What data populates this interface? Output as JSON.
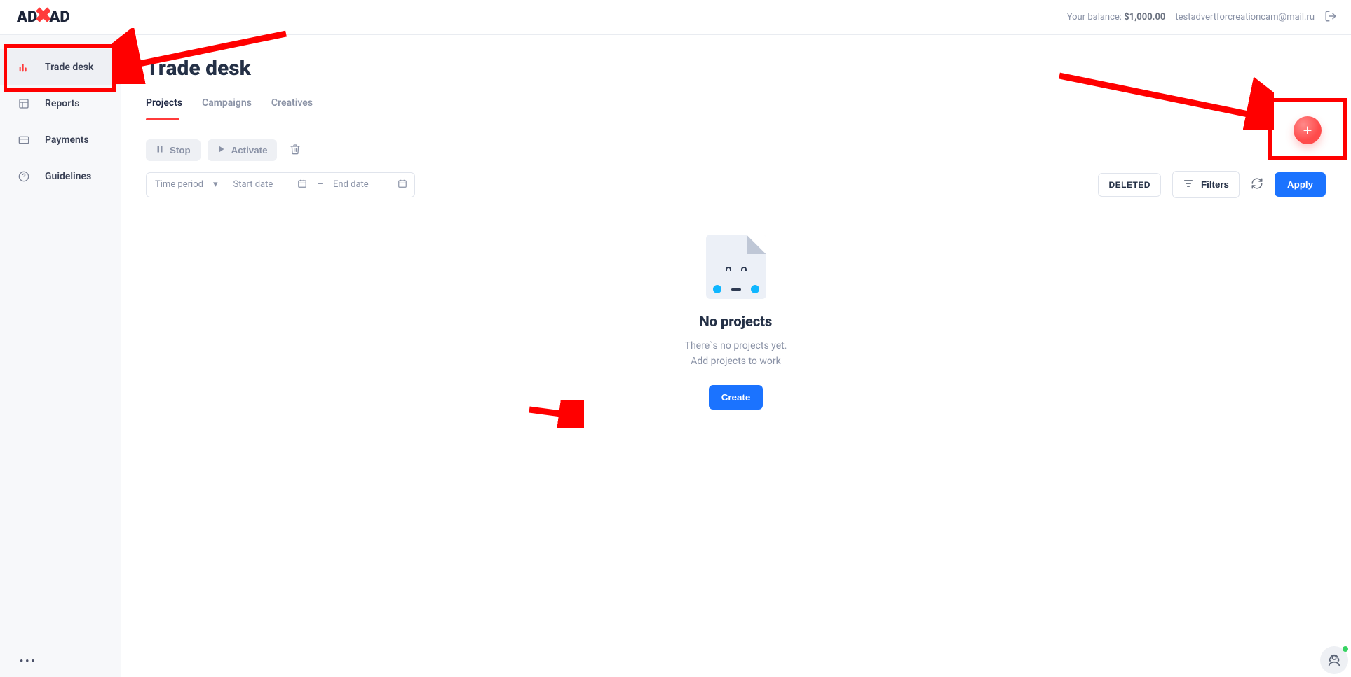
{
  "logo": {
    "a": "AD",
    "b": "AD"
  },
  "header": {
    "balance_label": "Your balance: ",
    "balance_value": "$1,000.00",
    "user_email": "testadvertforcreationcam@mail.ru"
  },
  "sidebar": {
    "items": [
      {
        "label": "Trade desk",
        "active": true
      },
      {
        "label": "Reports",
        "active": false
      },
      {
        "label": "Payments",
        "active": false
      },
      {
        "label": "Guidelines",
        "active": false
      }
    ]
  },
  "page": {
    "title": "Trade desk",
    "tabs": [
      {
        "label": "Projects",
        "active": true
      },
      {
        "label": "Campaigns",
        "active": false
      },
      {
        "label": "Creatives",
        "active": false
      }
    ]
  },
  "actions": {
    "stop": "Stop",
    "activate": "Activate"
  },
  "filters": {
    "period_label": "Time period",
    "start_placeholder": "Start date",
    "end_placeholder": "End date",
    "deleted": "DELETED",
    "filters": "Filters",
    "apply": "Apply"
  },
  "empty": {
    "title": "No projects",
    "subtitle": "There`s no projects yet.\nAdd projects to work",
    "create": "Create"
  }
}
